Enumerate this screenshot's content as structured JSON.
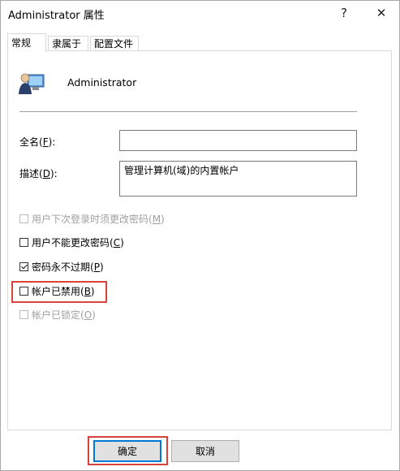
{
  "window": {
    "title": "Administrator 属性",
    "help_label": "?",
    "close_label": "✕"
  },
  "tabs": [
    {
      "label": "常规",
      "active": true
    },
    {
      "label": "隶属于",
      "active": false
    },
    {
      "label": "配置文件",
      "active": false
    }
  ],
  "general": {
    "user_icon": "user-icon",
    "user_name": "Administrator",
    "fullname": {
      "label": "全名(",
      "key": "F",
      "suffix": "):",
      "value": ""
    },
    "description": {
      "label": "描述(",
      "key": "D",
      "suffix": "):",
      "value": "管理计算机(域)的内置帐户"
    },
    "checkboxes": [
      {
        "label": "用户下次登录时须更改密码(",
        "key": "M",
        "suffix": ")",
        "checked": false,
        "disabled": true
      },
      {
        "label": "用户不能更改密码(",
        "key": "C",
        "suffix": ")",
        "checked": false,
        "disabled": false
      },
      {
        "label": "密码永不过期(",
        "key": "P",
        "suffix": ")",
        "checked": true,
        "disabled": false
      },
      {
        "label": "帐户已禁用(",
        "key": "B",
        "suffix": ")",
        "checked": false,
        "disabled": false
      },
      {
        "label": "帐户已锁定(",
        "key": "O",
        "suffix": ")",
        "checked": false,
        "disabled": true
      }
    ]
  },
  "buttons": {
    "ok": "确定",
    "cancel": "取消"
  },
  "colors": {
    "highlight": "#d9423a",
    "focus": "#0078d7"
  }
}
